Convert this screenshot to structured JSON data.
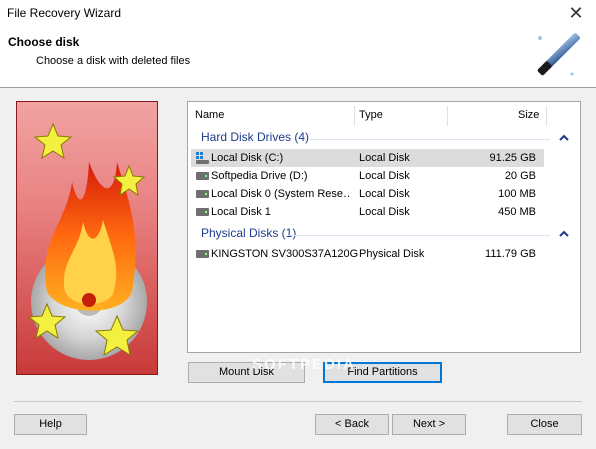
{
  "window": {
    "title": "File Recovery Wizard"
  },
  "header": {
    "title": "Choose disk",
    "subtitle": "Choose a disk with deleted files"
  },
  "list": {
    "columns": [
      "Name",
      "Type",
      "Size"
    ],
    "groups": [
      {
        "label": "Hard Disk Drives (4)",
        "rows": [
          {
            "name": "Local Disk (C:)",
            "type": "Local Disk",
            "size": "91.25 GB",
            "selected": true,
            "icon": "system-drive-icon"
          },
          {
            "name": "Softpedia Drive (D:)",
            "type": "Local Disk",
            "size": "20 GB",
            "selected": false,
            "icon": "hard-drive-icon"
          },
          {
            "name": "Local Disk 0 (System Rese…",
            "type": "Local Disk",
            "size": "100 MB",
            "selected": false,
            "icon": "hard-drive-icon"
          },
          {
            "name": "Local Disk 1",
            "type": "Local Disk",
            "size": "450 MB",
            "selected": false,
            "icon": "hard-drive-icon"
          }
        ]
      },
      {
        "label": "Physical Disks (1)",
        "rows": [
          {
            "name": "KINGSTON SV300S37A120G",
            "type": "Physical Disk",
            "size": "111.79 GB",
            "selected": false,
            "icon": "hard-drive-icon"
          }
        ]
      }
    ]
  },
  "actions": {
    "mount": "Mount Disk",
    "find": "Find Partitions"
  },
  "footer": {
    "help": "Help",
    "back": "< Back",
    "next": "Next >",
    "close": "Close"
  },
  "watermark": "SOFTPEDIA",
  "colors": {
    "accent": "#0078d7",
    "group_text": "#1e3c8c",
    "side_panel": "#e88080"
  }
}
